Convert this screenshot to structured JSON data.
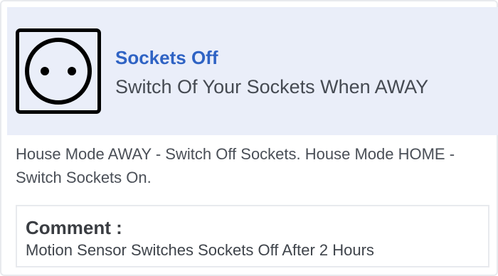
{
  "rule": {
    "icon": "power-socket-icon",
    "title": "Sockets Off",
    "subtitle": "Switch Of Your Sockets When AWAY",
    "description": "House Mode AWAY - Switch Off Sockets. House Mode HOME - Switch Sockets On.",
    "comment": {
      "label": "Comment :",
      "text": "Motion Sensor Switches Sockets Off After 2 Hours"
    }
  },
  "colors": {
    "header_background": "#eaeef9",
    "title": "#2f63c4",
    "icon_stroke": "#000000"
  }
}
